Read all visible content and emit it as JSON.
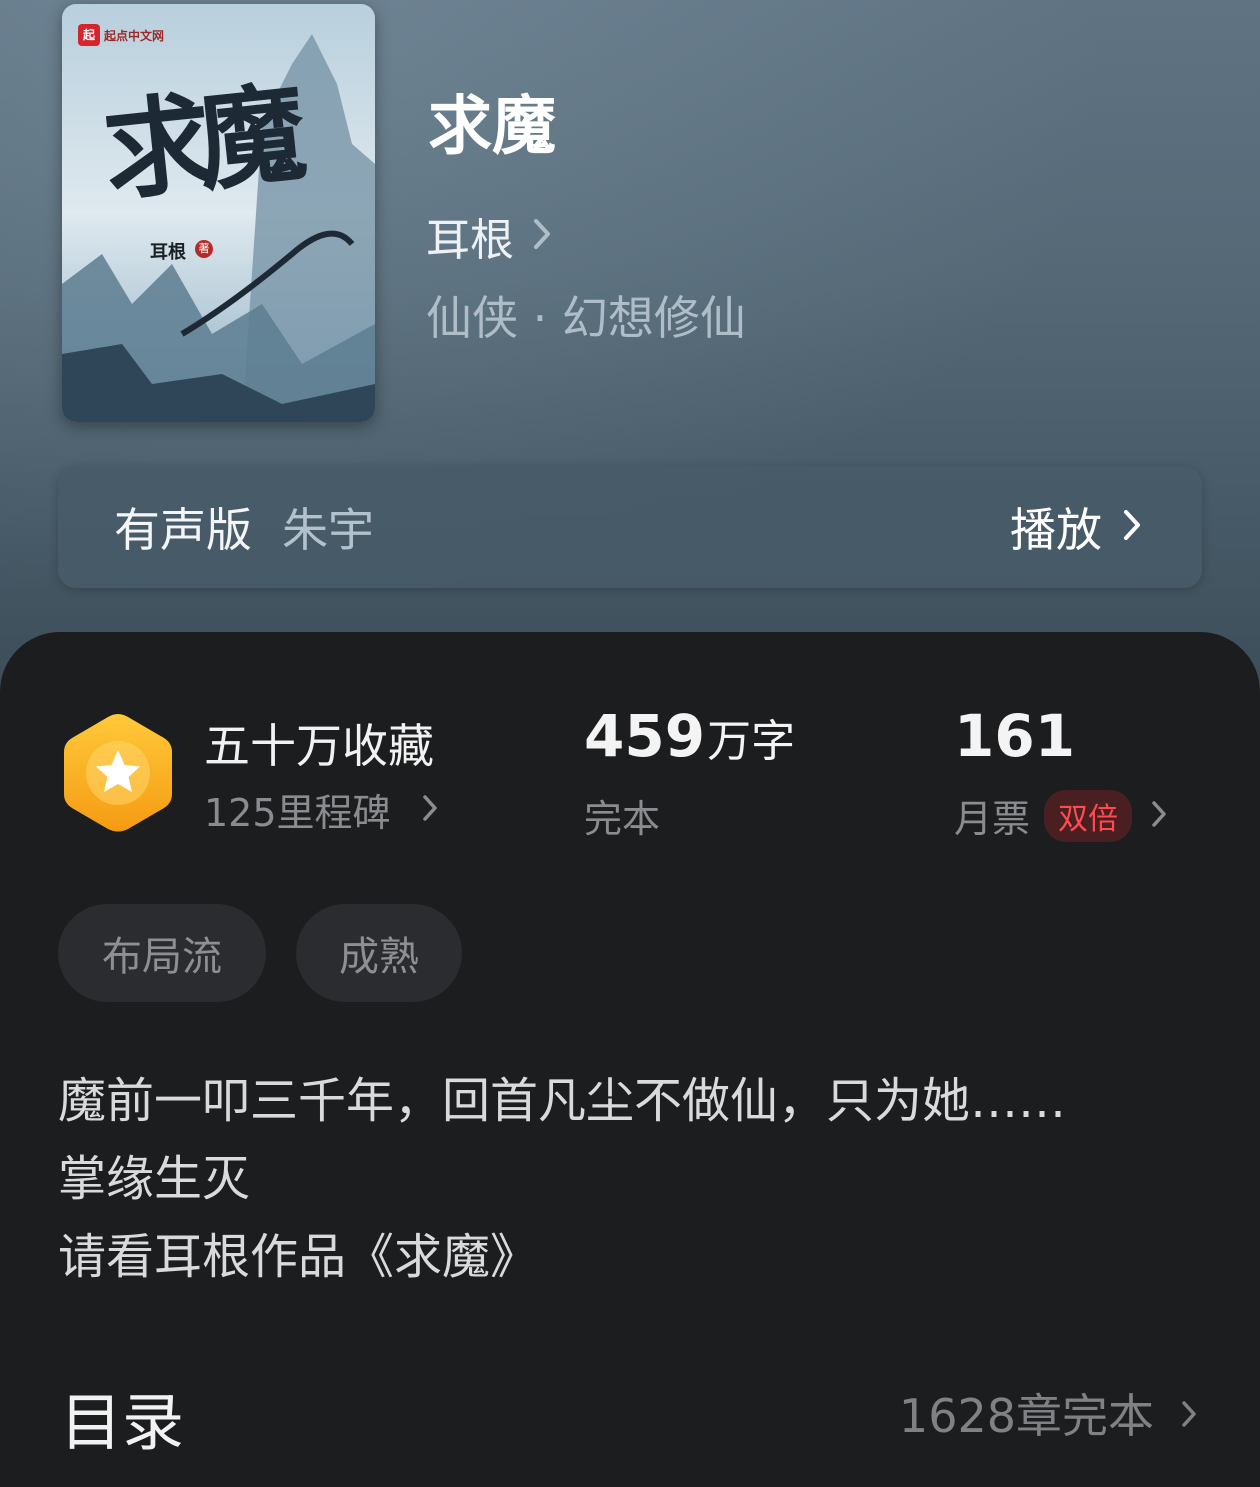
{
  "book": {
    "title": "求魔",
    "author": "耳根",
    "genre": "仙侠 · 幻想修仙",
    "cover": {
      "title": "求魔",
      "author": "耳根",
      "seal": "著",
      "publisher": "起点中文网",
      "publisher_logo": "起"
    }
  },
  "audio": {
    "label": "有声版",
    "narrator": "朱宇",
    "play_label": "播放"
  },
  "stats": {
    "collections": {
      "title": "五十万收藏",
      "subtitle": "125里程碑",
      "badge_icon": "star-hexagon-icon"
    },
    "words": {
      "number": "459",
      "unit": "万字",
      "status": "完本"
    },
    "monthly_tickets": {
      "number": "161",
      "label": "月票",
      "badge": "双倍"
    }
  },
  "tags": [
    "布局流",
    "成熟"
  ],
  "description": [
    "魔前一叩三千年，回首凡尘不做仙，只为她……",
    "掌缘生灭",
    "请看耳根作品《求魔》"
  ],
  "toc": {
    "title": "目录",
    "info": "1628章完本"
  },
  "colors": {
    "panel_bg": "#1c1d1f",
    "badge_orange": "#f5a623",
    "double_red": "#ff4a50"
  }
}
